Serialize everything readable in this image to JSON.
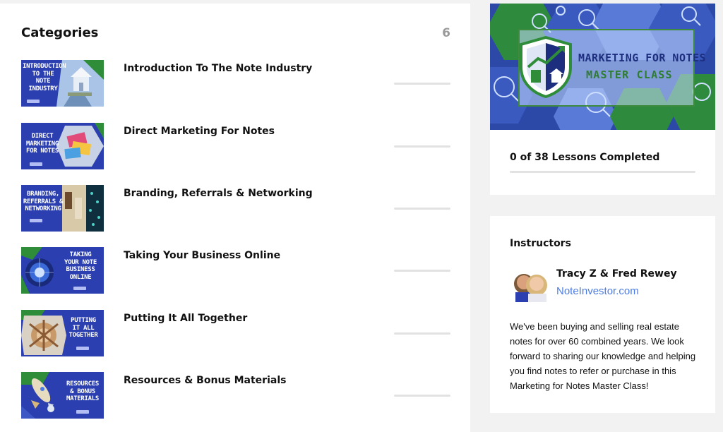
{
  "categories": {
    "title": "Categories",
    "count": "6",
    "items": [
      {
        "label": "Introduction To The Note Industry",
        "thumb_text": "INTRODUCTION\nTO THE\nNOTE\nINDUSTRY",
        "thumb_icon": "house-and-money-icon"
      },
      {
        "label": "Direct Marketing For Notes",
        "thumb_text": "DIRECT\nMARKETING\nFOR NOTES",
        "thumb_icon": "mail-envelopes-icon"
      },
      {
        "label": "Branding, Referrals & Networking",
        "thumb_text": "BRANDING,\nREFERRALS &\nNETWORKING",
        "thumb_icon": "network-people-icon"
      },
      {
        "label": "Taking Your Business Online",
        "thumb_text": "TAKING\nYOUR NOTE\nBUSINESS\nONLINE",
        "thumb_icon": "globe-network-icon"
      },
      {
        "label": "Putting It All Together",
        "thumb_text": "PUTTING\nIT ALL\nTOGETHER",
        "thumb_icon": "team-hands-icon"
      },
      {
        "label": "Resources & Bonus Materials",
        "thumb_text": "RESOURCES\n& BONUS\nMATERIALS",
        "thumb_icon": "rocket-icon"
      }
    ]
  },
  "course": {
    "hero_title_line1": "MARKETING FOR NOTES",
    "hero_title_line2": "MASTER CLASS",
    "hero_icon": "shield-chart-house-icon",
    "lessons_completed": "0 of 38 Lessons Completed",
    "progress": 0
  },
  "instructors": {
    "title": "Instructors",
    "name": "Tracy Z & Fred Rewey",
    "link": "NoteInvestor.com",
    "bio": "We've been buying and selling real estate notes for over 60 combined years. We look forward to sharing our knowledge and helping you find notes to refer or purchase in this Marketing for Notes Master Class!"
  },
  "colors": {
    "brand_blue": "#2b3fb0",
    "brand_green": "#2f7d2f",
    "link_blue": "#4a7be6",
    "muted_gray": "#9a9a9a"
  }
}
